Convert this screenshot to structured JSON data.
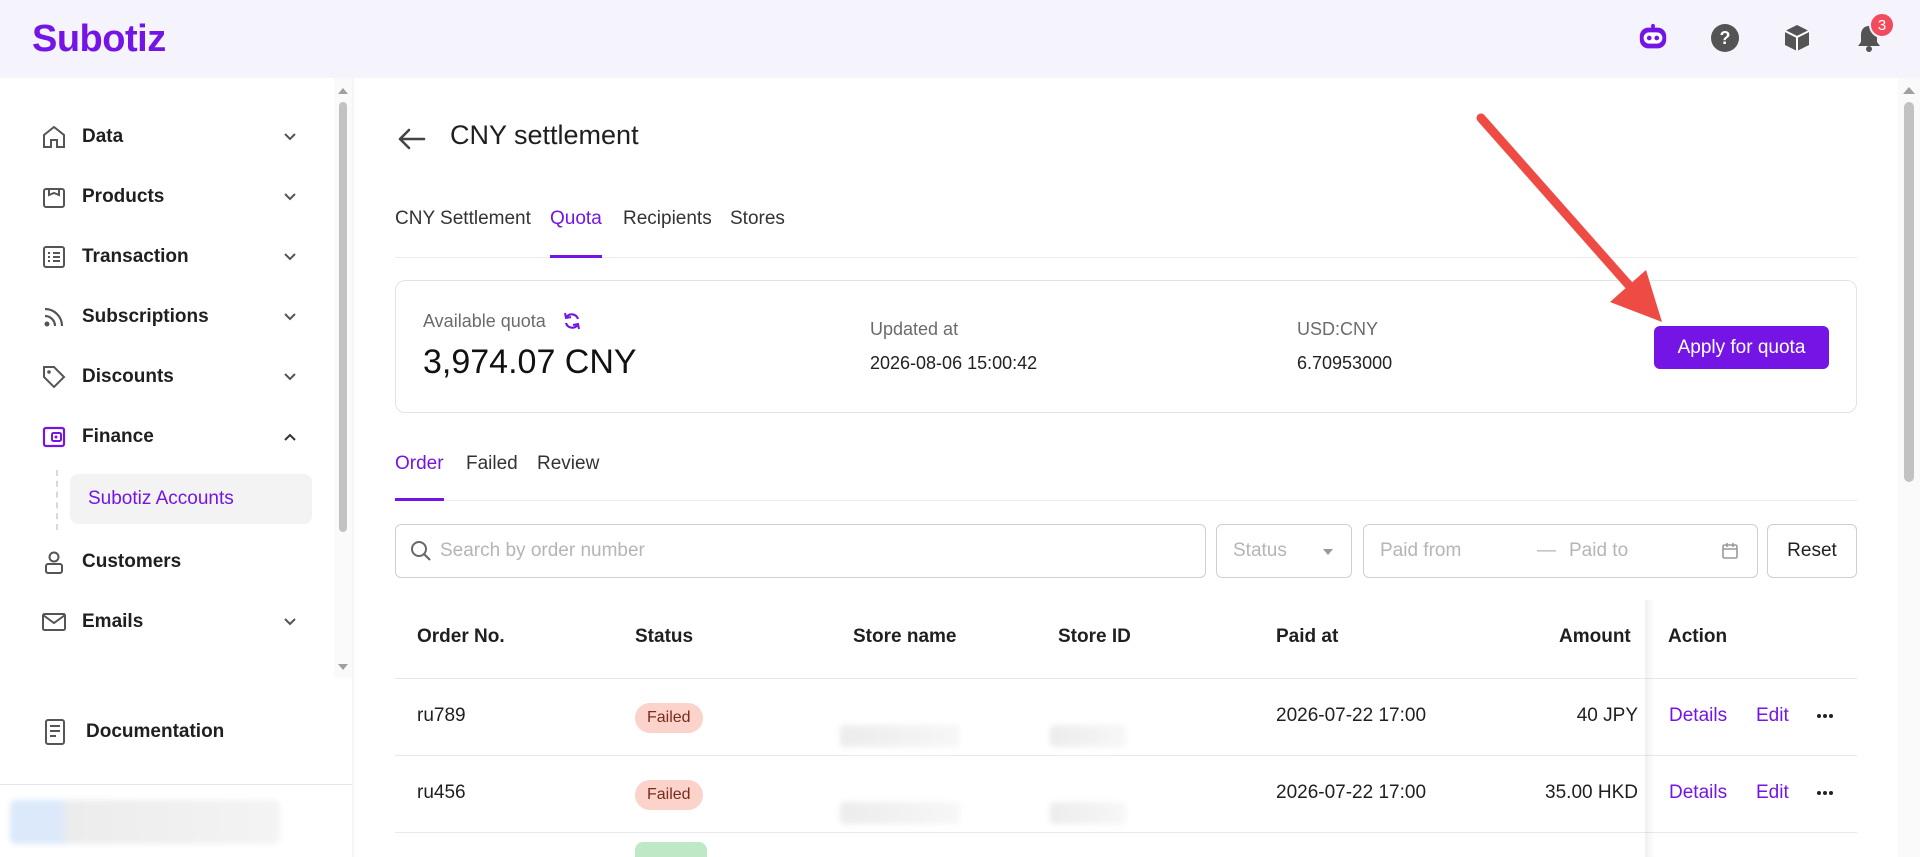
{
  "app": {
    "logo": "Subotiz",
    "notification_count": "3"
  },
  "header_icons": [
    "assistant-bot-icon",
    "help-icon",
    "package-icon",
    "bell-icon"
  ],
  "sidebar": {
    "items": [
      {
        "label": "Data",
        "icon": "home-icon"
      },
      {
        "label": "Products",
        "icon": "bag-icon"
      },
      {
        "label": "Transaction",
        "icon": "list-icon"
      },
      {
        "label": "Subscriptions",
        "icon": "rss-icon"
      },
      {
        "label": "Discounts",
        "icon": "tag-icon"
      },
      {
        "label": "Finance",
        "icon": "wallet-icon"
      },
      {
        "label": "Customers",
        "icon": "user-icon"
      },
      {
        "label": "Emails",
        "icon": "mail-icon"
      }
    ],
    "sub_item": "Subotiz Accounts",
    "documentation": "Documentation"
  },
  "page": {
    "title": "CNY settlement"
  },
  "tabs": [
    "CNY Settlement",
    "Quota",
    "Recipients",
    "Stores"
  ],
  "active_tab": "Quota",
  "quota": {
    "available_label": "Available quota",
    "available_value": "3,974.07 CNY",
    "updated_label": "Updated at",
    "updated_value": "2026-08-06 15:00:42",
    "rate_label": "USD:CNY",
    "rate_value": "6.70953000",
    "apply_button": "Apply for quota"
  },
  "subtabs": [
    "Order",
    "Failed",
    "Review"
  ],
  "active_subtab": "Order",
  "filters": {
    "search_placeholder": "Search by order number",
    "status_placeholder": "Status",
    "paid_from": "Paid from",
    "paid_to": "Paid to",
    "reset": "Reset"
  },
  "table": {
    "columns": [
      "Order No.",
      "Status",
      "Store name",
      "Store ID",
      "Paid at",
      "Amount",
      "Action"
    ],
    "rows": [
      {
        "order_no": "ru789",
        "status": "Failed",
        "paid_at": "2026-07-22 17:00",
        "amount": "40 JPY",
        "details": "Details",
        "edit": "Edit"
      },
      {
        "order_no": "ru456",
        "status": "Failed",
        "paid_at": "2026-07-22 17:00",
        "amount": "35.00 HKD",
        "details": "Details",
        "edit": "Edit"
      }
    ]
  },
  "colors": {
    "brand": "#7415e6",
    "failed_pill": "#fbd3ca",
    "annotation_arrow": "#ee4b45"
  }
}
